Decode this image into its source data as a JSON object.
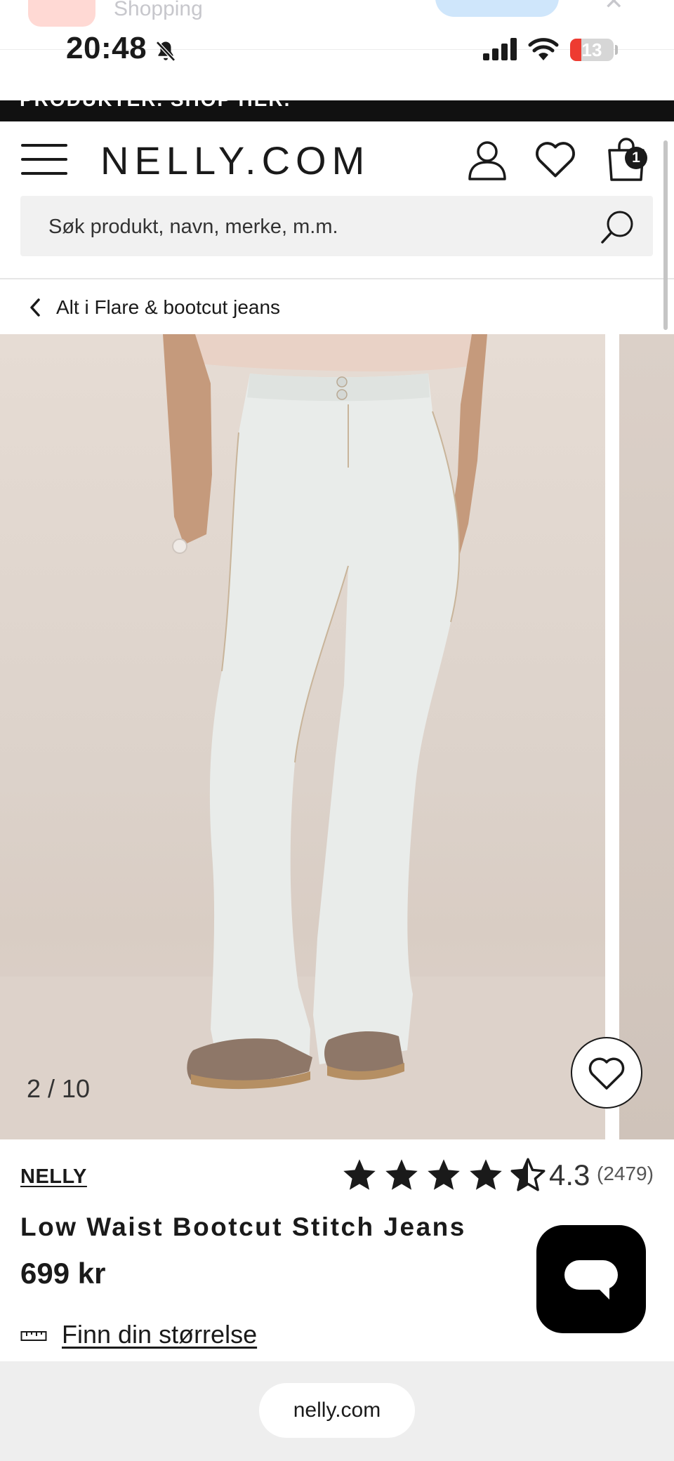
{
  "notification": {
    "app_label": "Shopping"
  },
  "status_bar": {
    "time": "20:48",
    "battery": "13",
    "icons": [
      "bell-slash-icon",
      "cellular-signal-icon",
      "wifi-icon",
      "battery-icon"
    ]
  },
  "promo": {
    "text": "PRODUKTER. SHOP HER."
  },
  "header": {
    "logo": "NELLY.COM",
    "bag_count": "1",
    "icons": [
      "menu-icon",
      "user-icon",
      "heart-icon",
      "bag-icon"
    ]
  },
  "search": {
    "placeholder": "Søk produkt, navn, merke, m.m."
  },
  "breadcrumb": {
    "label": "Alt i Flare & bootcut jeans"
  },
  "gallery": {
    "counter": "2 / 10",
    "current": 2,
    "total": 10
  },
  "product": {
    "brand": "NELLY",
    "rating": "4.3",
    "rating_value": 4.3,
    "review_count": "(2479)",
    "title": "Low Waist Bootcut Stitch Jeans",
    "price": "699 kr",
    "size_link": "Finn din størrelse"
  },
  "browser": {
    "url": "nelly.com"
  },
  "colors": {
    "accent": "#1a1a1a",
    "battery_low": "#ee3b31",
    "notif_button": "#cfe6fb",
    "search_bg": "#f1f1f1"
  }
}
